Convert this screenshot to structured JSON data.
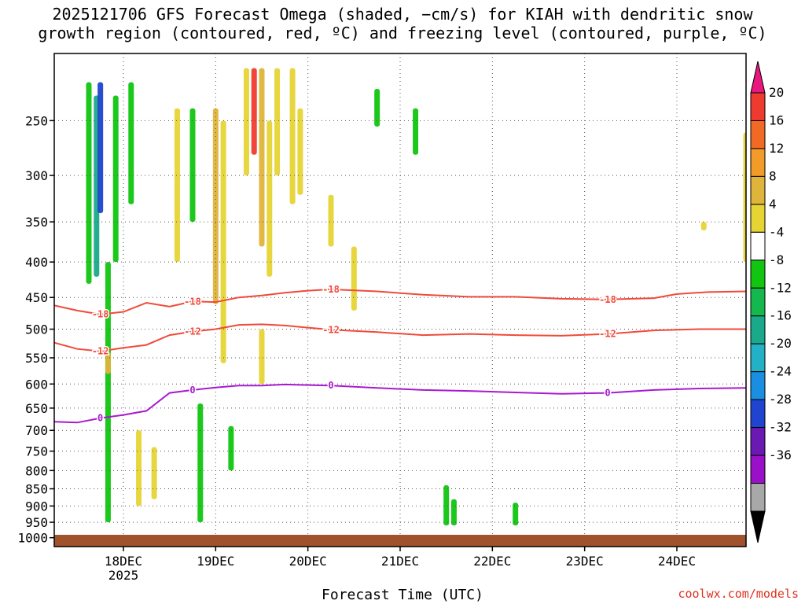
{
  "title_line1": "2025121706 GFS Forecast Omega (shaded, −cm/s) for KIAH with dendritic snow",
  "title_line2": "growth region (contoured, red, ºC) and freezing level (contoured, purple, ºC)",
  "xlabel": "Forecast Time (UTC)",
  "credit": "coolwx.com/models",
  "chart_data": {
    "type": "heatmap",
    "title": "2025121706 GFS Forecast Omega (shaded, −cm/s) for KIAH with dendritic snow growth region (contoured, red, ºC) and freezing level (contoured, purple, ºC)",
    "xlabel": "Forecast Time (UTC)",
    "ylabel": "",
    "y_scale": "log-pressure",
    "y_axis_inverted": true,
    "ylim": [
      1030,
      200
    ],
    "xlim": [
      "2025-12-17 06Z",
      "2025-12-24 18Z"
    ],
    "x_ticks": [
      {
        "label": "18DEC",
        "time": "2025-12-18 00Z"
      },
      {
        "label": "19DEC",
        "time": "2025-12-19 00Z"
      },
      {
        "label": "20DEC",
        "time": "2025-12-20 00Z"
      },
      {
        "label": "21DEC",
        "time": "2025-12-21 00Z"
      },
      {
        "label": "22DEC",
        "time": "2025-12-22 00Z"
      },
      {
        "label": "23DEC",
        "time": "2025-12-23 00Z"
      },
      {
        "label": "24DEC",
        "time": "2025-12-24 00Z"
      }
    ],
    "x_year_label": "2025",
    "y_ticks": [
      250,
      300,
      350,
      400,
      450,
      500,
      550,
      600,
      650,
      700,
      750,
      800,
      850,
      900,
      950,
      1000
    ],
    "grid": true,
    "colorbar": {
      "labels": [
        20,
        16,
        12,
        8,
        4,
        -4,
        -8,
        -12,
        -16,
        -20,
        -24,
        -28,
        -32,
        -36
      ],
      "colors": [
        "#e8177d",
        "#ee3b2f",
        "#f06a26",
        "#f29b28",
        "#dfb43a",
        "#e6d434",
        "#ffffff",
        "#11c511",
        "#15b84d",
        "#1aa98a",
        "#23b1c6",
        "#1a8fe2",
        "#1f44d0",
        "#6a1ab2",
        "#9a10c8",
        "#a8a8a8",
        "#000000"
      ]
    },
    "contours": [
      {
        "value": -18,
        "color": "#f04a3a",
        "points": [
          [
            0,
            462
          ],
          [
            6,
            470
          ],
          [
            12,
            476
          ],
          [
            18,
            472
          ],
          [
            24,
            458
          ],
          [
            30,
            464
          ],
          [
            36,
            456
          ],
          [
            42,
            457
          ],
          [
            48,
            450
          ],
          [
            54,
            447
          ],
          [
            60,
            443
          ],
          [
            66,
            440
          ],
          [
            72,
            438
          ],
          [
            84,
            441
          ],
          [
            96,
            446
          ],
          [
            108,
            449
          ],
          [
            120,
            449
          ],
          [
            132,
            452
          ],
          [
            144,
            453
          ],
          [
            156,
            451
          ],
          [
            162,
            445
          ],
          [
            170,
            442
          ],
          [
            180,
            441
          ]
        ]
      },
      {
        "value": -12,
        "color": "#f04a3a",
        "points": [
          [
            0,
            523
          ],
          [
            6,
            534
          ],
          [
            12,
            538
          ],
          [
            18,
            532
          ],
          [
            24,
            527
          ],
          [
            30,
            510
          ],
          [
            36,
            504
          ],
          [
            42,
            500
          ],
          [
            48,
            493
          ],
          [
            54,
            492
          ],
          [
            60,
            494
          ],
          [
            72,
            501
          ],
          [
            84,
            505
          ],
          [
            96,
            510
          ],
          [
            108,
            508
          ],
          [
            120,
            510
          ],
          [
            132,
            511
          ],
          [
            144,
            508
          ],
          [
            156,
            502
          ],
          [
            168,
            500
          ],
          [
            180,
            500
          ]
        ]
      },
      {
        "value": 0,
        "color": "#a81ad0",
        "points": [
          [
            0,
            680
          ],
          [
            6,
            682
          ],
          [
            12,
            672
          ],
          [
            18,
            665
          ],
          [
            24,
            656
          ],
          [
            30,
            618
          ],
          [
            36,
            612
          ],
          [
            42,
            607
          ],
          [
            48,
            603
          ],
          [
            54,
            603
          ],
          [
            60,
            601
          ],
          [
            72,
            603
          ],
          [
            84,
            608
          ],
          [
            96,
            612
          ],
          [
            108,
            614
          ],
          [
            120,
            617
          ],
          [
            132,
            620
          ],
          [
            144,
            618
          ],
          [
            156,
            612
          ],
          [
            168,
            609
          ],
          [
            180,
            608
          ]
        ]
      }
    ],
    "omega_regions": [
      {
        "t": 9,
        "p_top": 220,
        "p_bot": 430,
        "value": -8
      },
      {
        "t": 11,
        "p_top": 230,
        "p_bot": 420,
        "value": -16
      },
      {
        "t": 12,
        "p_top": 220,
        "p_bot": 340,
        "value": -28
      },
      {
        "t": 14,
        "p_top": 400,
        "p_bot": 950,
        "value": -8
      },
      {
        "t": 14,
        "p_top": 540,
        "p_bot": 580,
        "value": 8
      },
      {
        "t": 16,
        "p_top": 230,
        "p_bot": 400,
        "value": -8
      },
      {
        "t": 20,
        "p_top": 220,
        "p_bot": 330,
        "value": -8
      },
      {
        "t": 22,
        "p_top": 700,
        "p_bot": 900,
        "value": 4
      },
      {
        "t": 26,
        "p_top": 740,
        "p_bot": 880,
        "value": 4
      },
      {
        "t": 32,
        "p_top": 240,
        "p_bot": 400,
        "value": 4
      },
      {
        "t": 36,
        "p_top": 240,
        "p_bot": 350,
        "value": -8
      },
      {
        "t": 38,
        "p_top": 640,
        "p_bot": 950,
        "value": -8
      },
      {
        "t": 42,
        "p_top": 240,
        "p_bot": 460,
        "value": 8
      },
      {
        "t": 44,
        "p_top": 250,
        "p_bot": 560,
        "value": 4
      },
      {
        "t": 46,
        "p_top": 690,
        "p_bot": 800,
        "value": -8
      },
      {
        "t": 50,
        "p_top": 210,
        "p_bot": 300,
        "value": 4
      },
      {
        "t": 52,
        "p_top": 210,
        "p_bot": 280,
        "value": 20
      },
      {
        "t": 54,
        "p_top": 210,
        "p_bot": 380,
        "value": 8
      },
      {
        "t": 54,
        "p_top": 500,
        "p_bot": 600,
        "value": 4
      },
      {
        "t": 56,
        "p_top": 250,
        "p_bot": 420,
        "value": 4
      },
      {
        "t": 58,
        "p_top": 210,
        "p_bot": 300,
        "value": 4
      },
      {
        "t": 62,
        "p_top": 210,
        "p_bot": 330,
        "value": 4
      },
      {
        "t": 64,
        "p_top": 240,
        "p_bot": 320,
        "value": 4
      },
      {
        "t": 72,
        "p_top": 320,
        "p_bot": 380,
        "value": 4
      },
      {
        "t": 78,
        "p_top": 380,
        "p_bot": 470,
        "value": 4
      },
      {
        "t": 84,
        "p_top": 225,
        "p_bot": 255,
        "value": -8
      },
      {
        "t": 94,
        "p_top": 240,
        "p_bot": 280,
        "value": -8
      },
      {
        "t": 102,
        "p_top": 840,
        "p_bot": 960,
        "value": -8
      },
      {
        "t": 104,
        "p_top": 880,
        "p_bot": 960,
        "value": -8
      },
      {
        "t": 120,
        "p_top": 890,
        "p_bot": 960,
        "value": -8
      },
      {
        "t": 169,
        "p_top": 350,
        "p_bot": 360,
        "value": 4
      },
      {
        "t": 180,
        "p_top": 260,
        "p_bot": 400,
        "value": 4
      }
    ]
  }
}
